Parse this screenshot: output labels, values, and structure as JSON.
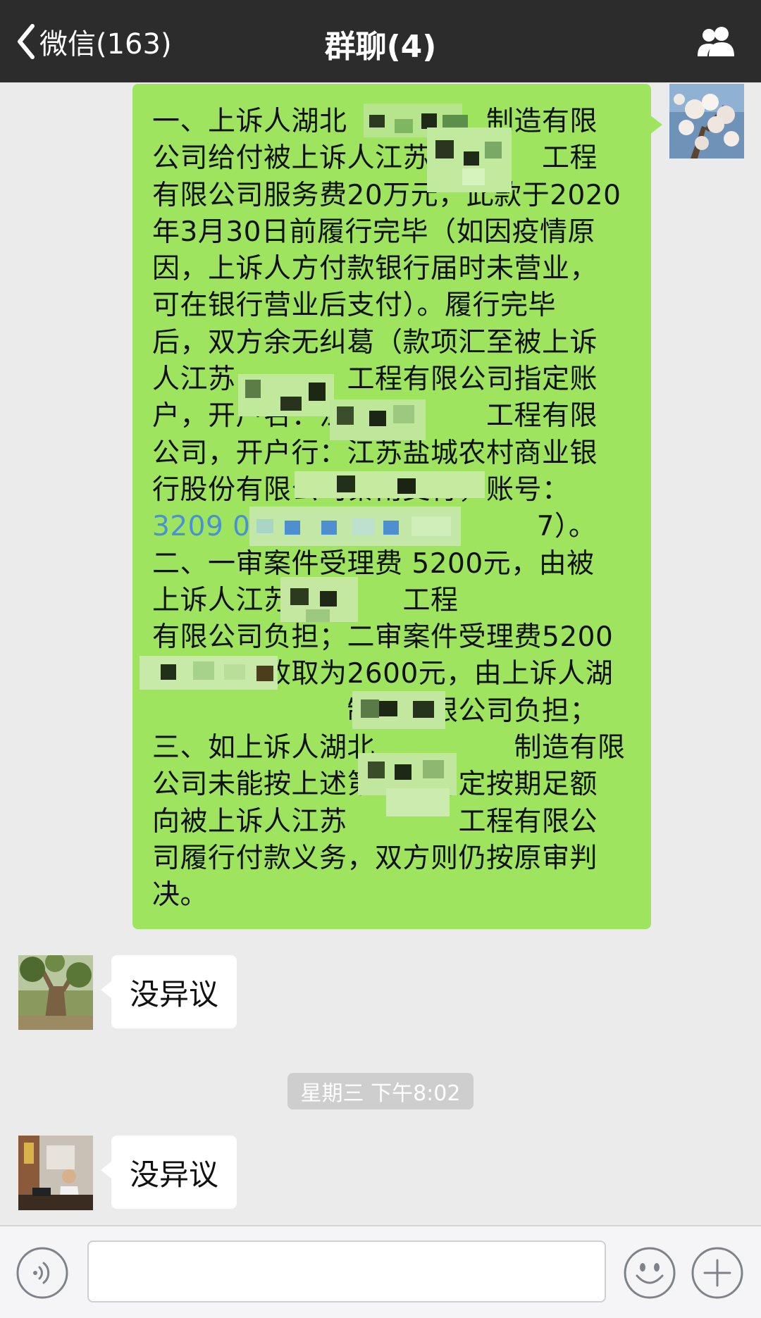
{
  "navbar": {
    "back_label": "微信(163)",
    "title": "群聊(4)",
    "back_icon": "chevron-left-icon",
    "members_icon": "group-members-icon"
  },
  "messages": [
    {
      "sender": "self",
      "text": "一、上诉人湖北　　　　　制造有限\n公司给付被上诉人江苏　　　　工程\n有限公司服务费20万元，此款于2020\n年3月30日前履行完毕（如因疫情原\n因，上诉人方付款银行届时未营业，\n可在银行营业后支付）。履行完毕\n后，双方余无纠葛（款项汇至被上诉\n人江苏　　　　工程有限公司指定账\n户，开户名：江苏　　　　工程有限\n公司，开户行：江苏盐城农村商业银\n行股份有限公司秦南支行，账号：\n3209 021　　　　　　　　　7）。\n二、一审案件受理费 5200元，由被\n上诉人江苏　　　　工程\n有限公司负担；二审案件受理费5200\n元，减半收取为2600元，由上诉人湖\n　　　　　　　制造有限公司负担；\n三、如上诉人湖北　　　　　制造有限\n公司未能按上述第一条约定按期足额\n向被上诉人江苏　　　　工程有限公\n司履行付款义务，双方则仍按原审判\n决。",
      "account_prefix": "3209 021",
      "account_suffix": "7）。"
    },
    {
      "sender": "member",
      "text": "没异议"
    },
    {
      "sender": "member",
      "text": "没异议"
    }
  ],
  "timestamp": "星期三 下午8:02",
  "input_bar": {
    "voice_icon": "voice-icon",
    "emoji_icon": "emoji-icon",
    "plus_icon": "plus-icon",
    "placeholder": ""
  },
  "colors": {
    "nav_bg": "#2c2c2c",
    "chat_bg": "#ebebeb",
    "outgoing_bubble": "#9fe45e",
    "incoming_bubble": "#ffffff",
    "link_blue": "#4a90d9"
  }
}
